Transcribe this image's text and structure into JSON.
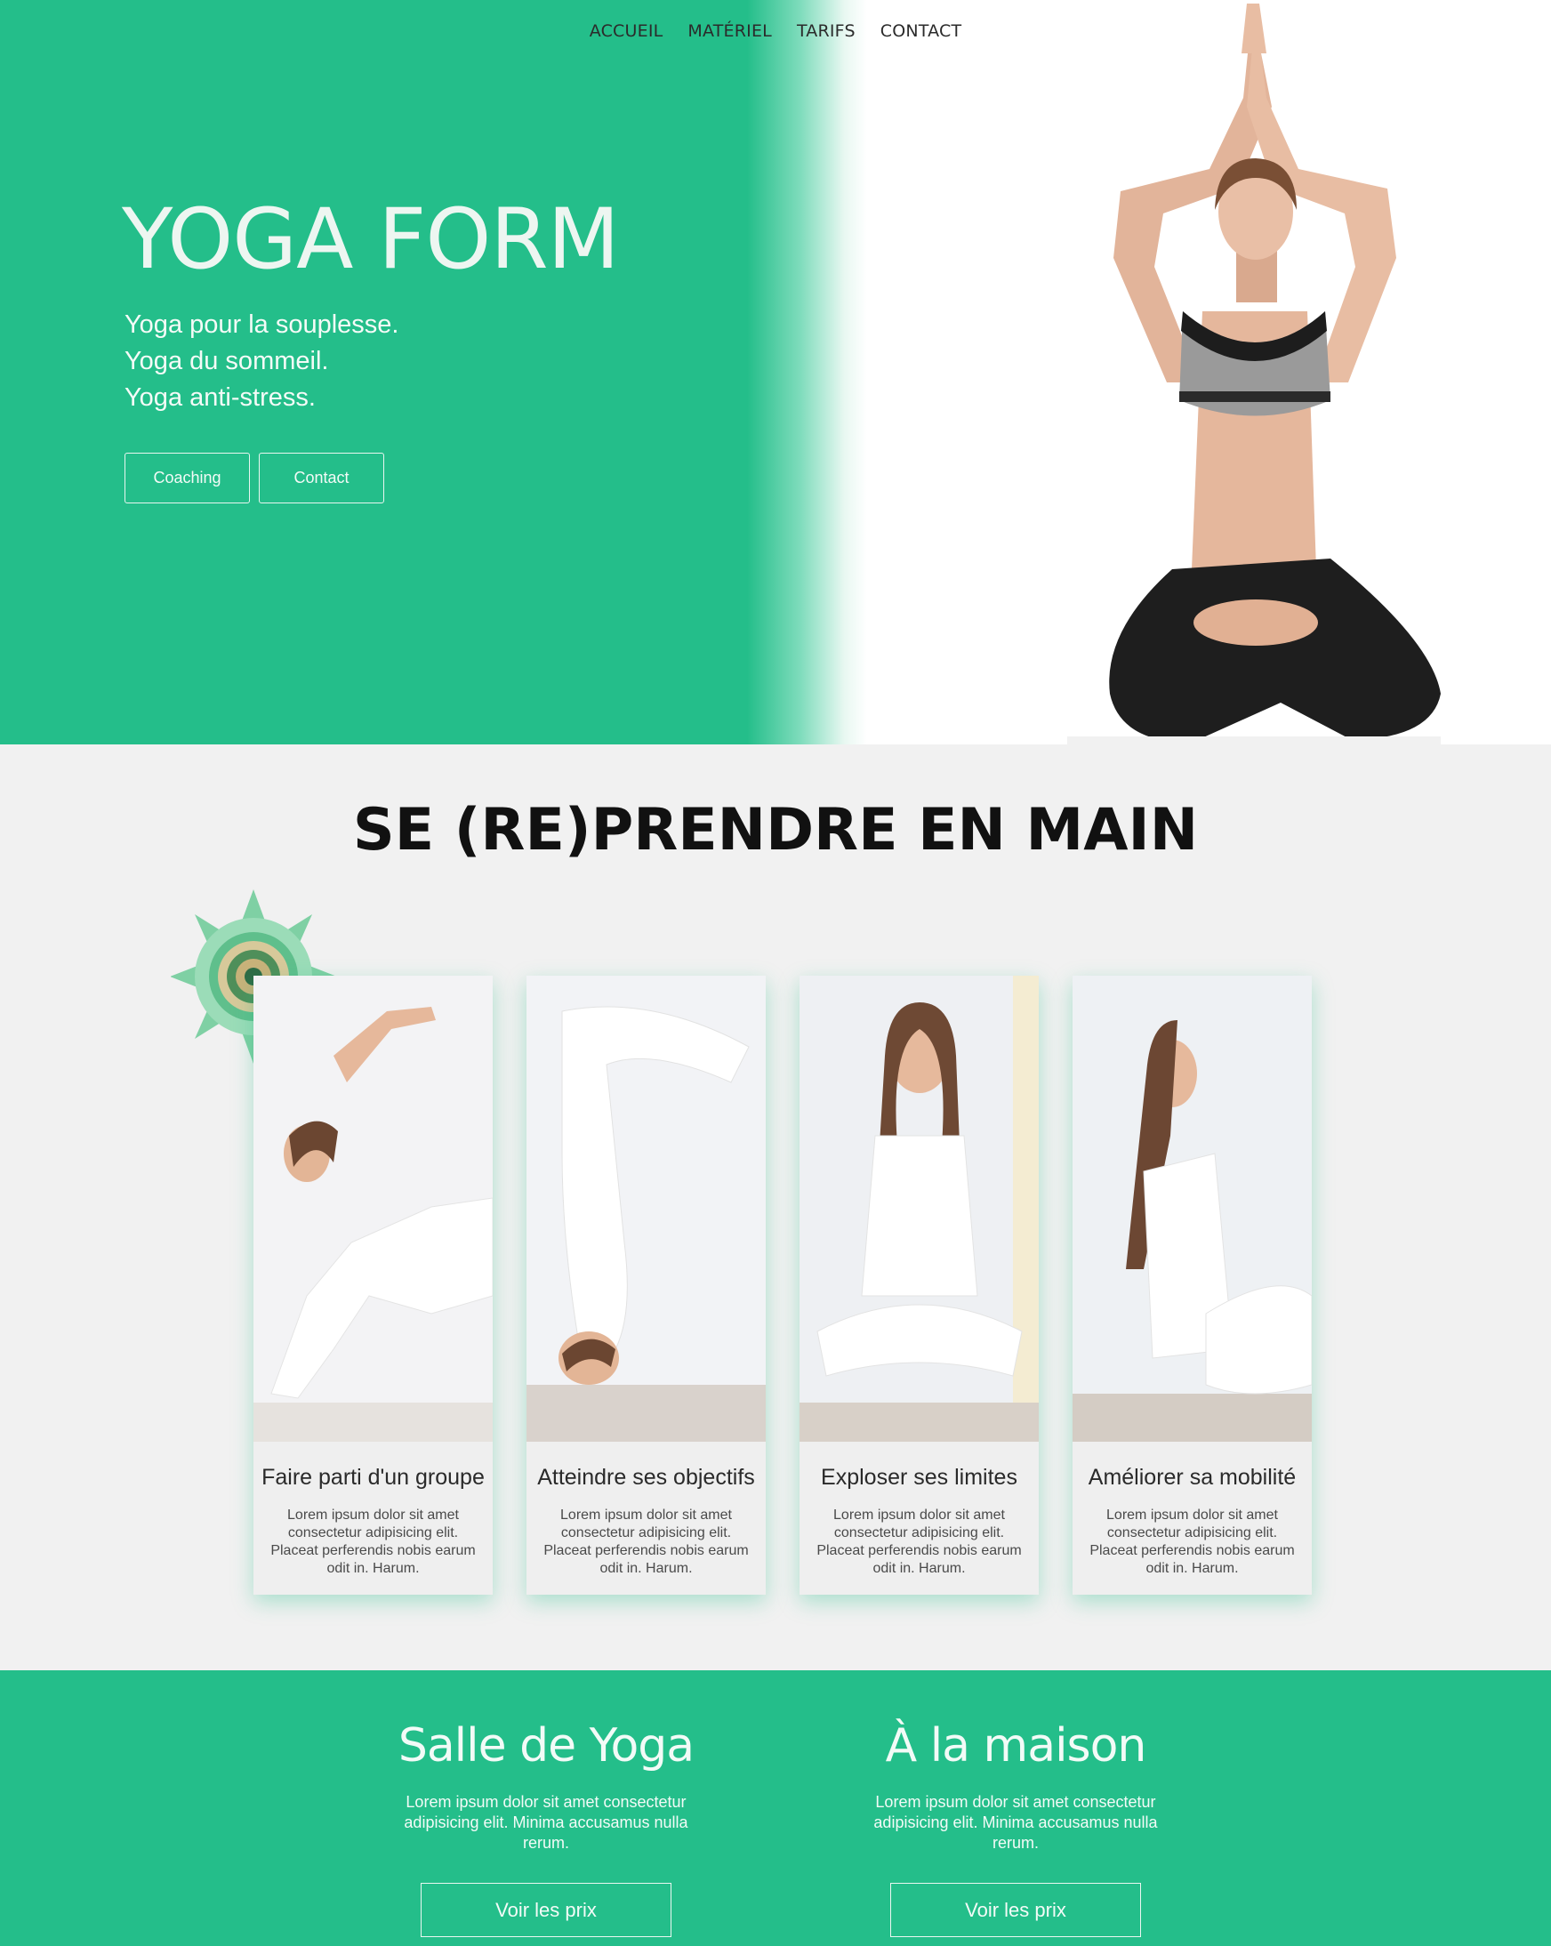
{
  "nav": {
    "items": [
      {
        "label": "ACCUEIL"
      },
      {
        "label": "MATÉRIEL"
      },
      {
        "label": "TARIFS"
      },
      {
        "label": "CONTACT"
      }
    ]
  },
  "hero": {
    "title": "YOGA FORM",
    "tagline": [
      "Yoga pour la souplesse.",
      "Yoga du sommeil.",
      "Yoga anti-stress."
    ],
    "buttons": [
      {
        "label": "Coaching"
      },
      {
        "label": "Contact"
      }
    ]
  },
  "section": {
    "title": "SE (RE)PRENDRE EN MAIN",
    "cards": [
      {
        "title": "Faire parti d'un groupe",
        "text": "Lorem ipsum dolor sit amet consectetur adipisicing elit. Placeat perferendis nobis earum odit in. Harum."
      },
      {
        "title": "Atteindre ses objectifs",
        "text": "Lorem ipsum dolor sit amet consectetur adipisicing elit. Placeat perferendis nobis earum odit in. Harum."
      },
      {
        "title": "Exploser ses limites",
        "text": "Lorem ipsum dolor sit amet consectetur adipisicing elit. Placeat perferendis nobis earum odit in. Harum."
      },
      {
        "title": "Améliorer sa mobilité",
        "text": "Lorem ipsum dolor sit amet consectetur adipisicing elit. Placeat perferendis nobis earum odit in. Harum."
      }
    ]
  },
  "offers": [
    {
      "title": "Salle de Yoga",
      "text": "Lorem ipsum dolor sit amet consectetur adipisicing elit. Minima accusamus nulla rerum.",
      "button": "Voir les prix"
    },
    {
      "title": "À la maison",
      "text": "Lorem ipsum dolor sit amet consectetur adipisicing elit. Minima accusamus nulla rerum.",
      "button": "Voir les prix"
    }
  ],
  "colors": {
    "brand_green": "#24be8a",
    "section_bg": "#f1f1f1"
  }
}
